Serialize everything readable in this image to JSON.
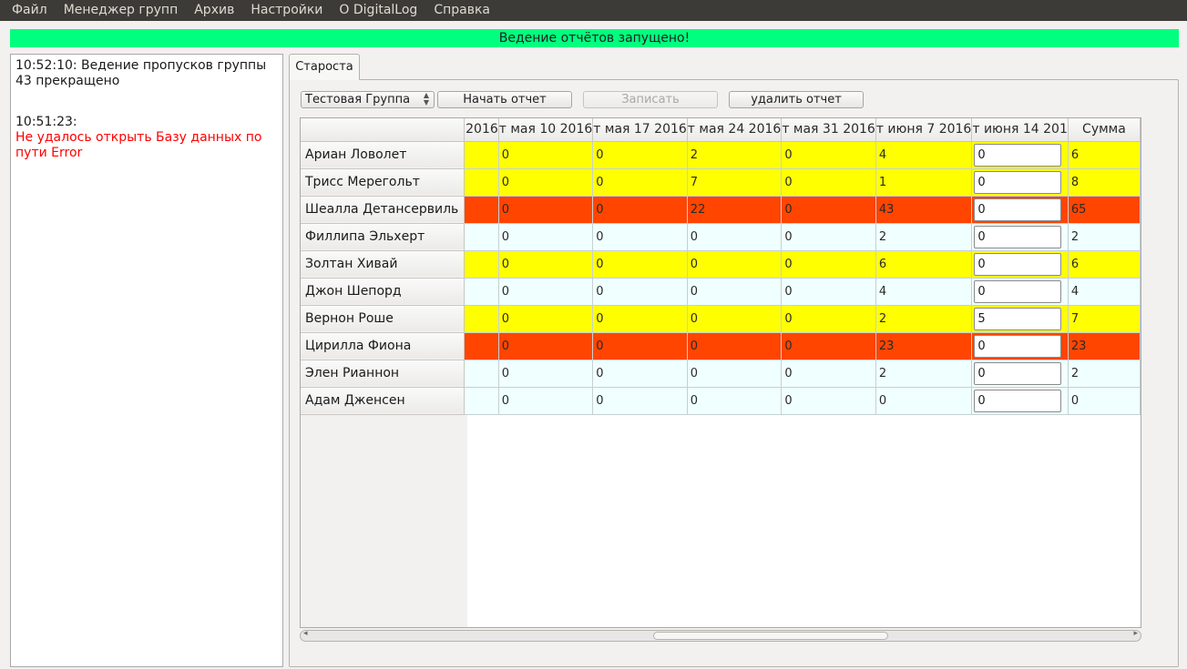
{
  "menu": [
    "Файл",
    "Менеджер групп",
    "Архив",
    "Настройки",
    "О DigitalLog",
    "Справка"
  ],
  "status_banner": "Ведение отчётов запущено!",
  "log": {
    "entry1": "10:52:10: Ведение пропусков группы 43 прекращено",
    "entry2_time": "10:51:23:",
    "entry2_error": "Не удалось открыть Базу данных по пути Error"
  },
  "tab_label": "Староста",
  "toolbar": {
    "group_select": "Тестовая Группа",
    "start_button": "Начать отчет",
    "save_button": "Записать",
    "delete_button": "удалить отчет"
  },
  "table": {
    "headers": [
      "2016",
      "т мая 10 2016",
      "т мая 17 2016",
      "т мая 24 2016",
      "т мая 31 2016",
      "т июня 7 2016",
      "т июня 14 201",
      "Сумма"
    ],
    "rows": [
      {
        "name": "Ариан Ловолет",
        "values": [
          "0",
          "0",
          "2",
          "0",
          "4"
        ],
        "input": "0",
        "sum": "6",
        "color": "#ffff00"
      },
      {
        "name": "Трисс Мерегольт",
        "values": [
          "0",
          "0",
          "7",
          "0",
          "1"
        ],
        "input": "0",
        "sum": "8",
        "color": "#ffff00"
      },
      {
        "name": "Шеалла Детансервиль",
        "values": [
          "0",
          "0",
          "22",
          "0",
          "43"
        ],
        "input": "0",
        "sum": "65",
        "color": "#ff4500"
      },
      {
        "name": "Филлипа Эльхерт",
        "values": [
          "0",
          "0",
          "0",
          "0",
          "2"
        ],
        "input": "0",
        "sum": "2",
        "color": "#f0ffff"
      },
      {
        "name": "Золтан Хивай",
        "values": [
          "0",
          "0",
          "0",
          "0",
          "6"
        ],
        "input": "0",
        "sum": "6",
        "color": "#ffff00"
      },
      {
        "name": "Джон Шепорд",
        "values": [
          "0",
          "0",
          "0",
          "0",
          "4"
        ],
        "input": "0",
        "sum": "4",
        "color": "#f0ffff"
      },
      {
        "name": "Вернон Роше",
        "values": [
          "0",
          "0",
          "0",
          "0",
          "2"
        ],
        "input": "5",
        "sum": "7",
        "color": "#ffff00"
      },
      {
        "name": "Цирилла Фиона",
        "values": [
          "0",
          "0",
          "0",
          "0",
          "23"
        ],
        "input": "0",
        "sum": "23",
        "color": "#ff4500"
      },
      {
        "name": "Элен Рианнон",
        "values": [
          "0",
          "0",
          "0",
          "0",
          "2"
        ],
        "input": "0",
        "sum": "2",
        "color": "#f0ffff"
      },
      {
        "name": "Адам Дженсен",
        "values": [
          "0",
          "0",
          "0",
          "0",
          "0"
        ],
        "input": "0",
        "sum": "0",
        "color": "#f0ffff"
      }
    ]
  }
}
